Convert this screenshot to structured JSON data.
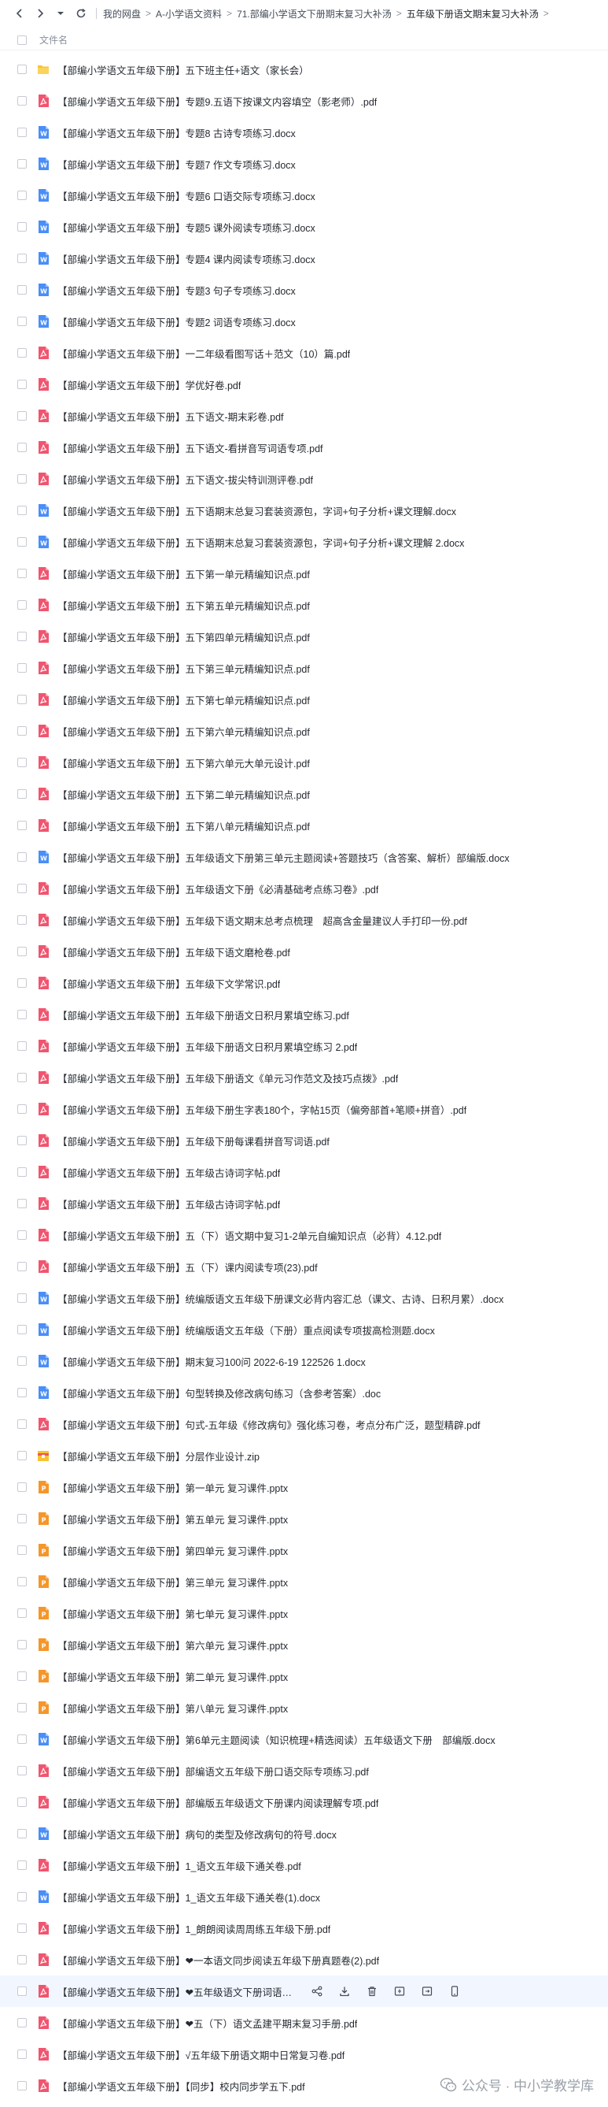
{
  "breadcrumb": {
    "items": [
      "我的网盘",
      "A-小学语文资料",
      "71.部编小学语文下册期末复习大补汤",
      "五年级下册语文期末复习大补汤"
    ],
    "separator": ">"
  },
  "header": {
    "name_column": "文件名"
  },
  "colors": {
    "pdf": "#f0556f",
    "word": "#4a8ef7",
    "folder": "#f8c233",
    "ppt": "#f5962a",
    "zip": "#f8c233",
    "hover_row": "#f2f7ff"
  },
  "files": [
    {
      "type": "folder",
      "name": "【部编小学语文五年级下册】五下班主任+语文（家长会）"
    },
    {
      "type": "pdf",
      "name": "【部编小学语文五年级下册】专题9.五语下按课文内容填空（影老师）.pdf"
    },
    {
      "type": "word",
      "name": "【部编小学语文五年级下册】专题8 古诗专项练习.docx"
    },
    {
      "type": "word",
      "name": "【部编小学语文五年级下册】专题7 作文专项练习.docx"
    },
    {
      "type": "word",
      "name": "【部编小学语文五年级下册】专题6 口语交际专项练习.docx"
    },
    {
      "type": "word",
      "name": "【部编小学语文五年级下册】专题5 课外阅读专项练习.docx"
    },
    {
      "type": "word",
      "name": "【部编小学语文五年级下册】专题4 课内阅读专项练习.docx"
    },
    {
      "type": "word",
      "name": "【部编小学语文五年级下册】专题3 句子专项练习.docx"
    },
    {
      "type": "word",
      "name": "【部编小学语文五年级下册】专题2 词语专项练习.docx"
    },
    {
      "type": "pdf",
      "name": "【部编小学语文五年级下册】一二年级看图写话＋范文（10）篇.pdf"
    },
    {
      "type": "pdf",
      "name": "【部编小学语文五年级下册】学优好卷.pdf"
    },
    {
      "type": "pdf",
      "name": "【部编小学语文五年级下册】五下语文-期末彩卷.pdf"
    },
    {
      "type": "pdf",
      "name": "【部编小学语文五年级下册】五下语文-看拼音写词语专项.pdf"
    },
    {
      "type": "pdf",
      "name": "【部编小学语文五年级下册】五下语文-拔尖特训测评卷.pdf"
    },
    {
      "type": "word",
      "name": "【部编小学语文五年级下册】五下语期末总复习套装资源包，字词+句子分析+课文理解.docx"
    },
    {
      "type": "word",
      "name": "【部编小学语文五年级下册】五下语期末总复习套装资源包，字词+句子分析+课文理解 2.docx"
    },
    {
      "type": "pdf",
      "name": "【部编小学语文五年级下册】五下第一单元精编知识点.pdf"
    },
    {
      "type": "pdf",
      "name": "【部编小学语文五年级下册】五下第五单元精编知识点.pdf"
    },
    {
      "type": "pdf",
      "name": "【部编小学语文五年级下册】五下第四单元精编知识点.pdf"
    },
    {
      "type": "pdf",
      "name": "【部编小学语文五年级下册】五下第三单元精编知识点.pdf"
    },
    {
      "type": "pdf",
      "name": "【部编小学语文五年级下册】五下第七单元精编知识点.pdf"
    },
    {
      "type": "pdf",
      "name": "【部编小学语文五年级下册】五下第六单元精编知识点.pdf"
    },
    {
      "type": "pdf",
      "name": "【部编小学语文五年级下册】五下第六单元大单元设计.pdf"
    },
    {
      "type": "pdf",
      "name": "【部编小学语文五年级下册】五下第二单元精编知识点.pdf"
    },
    {
      "type": "pdf",
      "name": "【部编小学语文五年级下册】五下第八单元精编知识点.pdf"
    },
    {
      "type": "word",
      "name": "【部编小学语文五年级下册】五年级语文下册第三单元主题阅读+答题技巧（含答案、解析）部编版.docx"
    },
    {
      "type": "pdf",
      "name": "【部编小学语文五年级下册】五年级语文下册《必清基础考点练习卷》.pdf"
    },
    {
      "type": "pdf",
      "name": "【部编小学语文五年级下册】五年级下语文期末总考点梳理　超高含金量建议人手打印一份.pdf"
    },
    {
      "type": "pdf",
      "name": "【部编小学语文五年级下册】五年级下语文磨枪卷.pdf"
    },
    {
      "type": "pdf",
      "name": "【部编小学语文五年级下册】五年级下文学常识.pdf"
    },
    {
      "type": "pdf",
      "name": "【部编小学语文五年级下册】五年级下册语文日积月累填空练习.pdf"
    },
    {
      "type": "pdf",
      "name": "【部编小学语文五年级下册】五年级下册语文日积月累填空练习 2.pdf"
    },
    {
      "type": "pdf",
      "name": "【部编小学语文五年级下册】五年级下册语文《单元习作范文及技巧点拨》.pdf"
    },
    {
      "type": "pdf",
      "name": "【部编小学语文五年级下册】五年级下册生字表180个，字帖15页（偏旁部首+笔顺+拼音）.pdf"
    },
    {
      "type": "pdf",
      "name": "【部编小学语文五年级下册】五年级下册每课看拼音写词语.pdf"
    },
    {
      "type": "pdf",
      "name": "【部编小学语文五年级下册】五年级古诗词字帖.pdf"
    },
    {
      "type": "pdf",
      "name": "【部编小学语文五年级下册】五年级古诗词字帖.pdf"
    },
    {
      "type": "pdf",
      "name": "【部编小学语文五年级下册】五（下）语文期中复习1-2单元自编知识点（必背）4.12.pdf"
    },
    {
      "type": "pdf",
      "name": "【部编小学语文五年级下册】五（下）课内阅读专项(23).pdf"
    },
    {
      "type": "word",
      "name": "【部编小学语文五年级下册】统编版语文五年级下册课文必背内容汇总（课文、古诗、日积月累）.docx"
    },
    {
      "type": "word",
      "name": "【部编小学语文五年级下册】统编版语文五年级（下册）重点阅读专项拔高检测题.docx"
    },
    {
      "type": "word",
      "name": "【部编小学语文五年级下册】期末复习100问 2022-6-19 122526 1.docx"
    },
    {
      "type": "word",
      "name": "【部编小学语文五年级下册】句型转换及修改病句练习（含参考答案）.doc"
    },
    {
      "type": "pdf",
      "name": "【部编小学语文五年级下册】句式-五年级《修改病句》强化练习卷，考点分布广泛，题型精辟.pdf"
    },
    {
      "type": "zip",
      "name": "【部编小学语文五年级下册】分层作业设计.zip"
    },
    {
      "type": "ppt",
      "name": "【部编小学语文五年级下册】第一单元 复习课件.pptx"
    },
    {
      "type": "ppt",
      "name": "【部编小学语文五年级下册】第五单元 复习课件.pptx"
    },
    {
      "type": "ppt",
      "name": "【部编小学语文五年级下册】第四单元 复习课件.pptx"
    },
    {
      "type": "ppt",
      "name": "【部编小学语文五年级下册】第三单元 复习课件.pptx"
    },
    {
      "type": "ppt",
      "name": "【部编小学语文五年级下册】第七单元 复习课件.pptx"
    },
    {
      "type": "ppt",
      "name": "【部编小学语文五年级下册】第六单元 复习课件.pptx"
    },
    {
      "type": "ppt",
      "name": "【部编小学语文五年级下册】第二单元 复习课件.pptx"
    },
    {
      "type": "ppt",
      "name": "【部编小学语文五年级下册】第八单元 复习课件.pptx"
    },
    {
      "type": "word",
      "name": "【部编小学语文五年级下册】第6单元主题阅读（知识梳理+精选阅读）五年级语文下册　部编版.docx"
    },
    {
      "type": "pdf",
      "name": "【部编小学语文五年级下册】部编语文五年级下册口语交际专项练习.pdf"
    },
    {
      "type": "pdf",
      "name": "【部编小学语文五年级下册】部编版五年级语文下册课内阅读理解专项.pdf"
    },
    {
      "type": "word",
      "name": "【部编小学语文五年级下册】病句的类型及修改病句的符号.docx"
    },
    {
      "type": "pdf",
      "name": "【部编小学语文五年级下册】1_语文五年级下通关卷.pdf"
    },
    {
      "type": "word",
      "name": "【部编小学语文五年级下册】1_语文五年级下通关卷(1).docx"
    },
    {
      "type": "pdf",
      "name": "【部编小学语文五年级下册】1_朗朗阅读周周练五年级下册.pdf"
    },
    {
      "type": "pdf",
      "name": "【部编小学语文五年级下册】❤一本语文同步阅读五年级下册真题卷(2).pdf"
    },
    {
      "type": "pdf",
      "name": "【部编小学语文五年级下册】❤五年级语文下册词语专项...",
      "hover": true
    },
    {
      "type": "pdf",
      "name": "【部编小学语文五年级下册】❤五（下）语文孟建平期末复习手册.pdf"
    },
    {
      "type": "pdf",
      "name": "【部编小学语文五年级下册】√五年级下册语文期中日常复习卷.pdf"
    },
    {
      "type": "pdf",
      "name": "【部编小学语文五年级下册】【同步】校内同步学五下.pdf"
    }
  ],
  "row_actions": [
    "share-icon",
    "download-icon",
    "delete-icon",
    "rename-icon",
    "move-icon",
    "mobile-icon"
  ],
  "watermark": {
    "text": "公众号 · 中小学教学库"
  }
}
